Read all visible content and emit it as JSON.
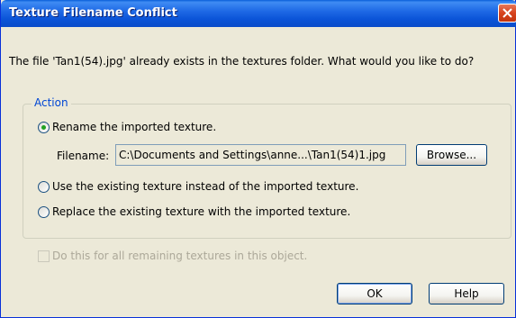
{
  "window": {
    "title": "Texture Filename Conflict"
  },
  "message": "The file 'Tan1(54).jpg' already exists in the textures folder.  What would you like to do?",
  "action_group": {
    "label": "Action",
    "options": [
      {
        "label": "Rename the imported texture.",
        "selected": true
      },
      {
        "label": "Use the existing texture instead of the imported texture.",
        "selected": false
      },
      {
        "label": "Replace the existing texture with the imported texture.",
        "selected": false
      }
    ],
    "filename": {
      "label": "Filename:",
      "value": "C:\\Documents and Settings\\anne...\\Tan1(54)1.jpg"
    },
    "browse_label": "Browse..."
  },
  "apply_all": {
    "label": "Do this for all remaining textures in this object.",
    "checked": false,
    "enabled": false
  },
  "buttons": {
    "ok": "OK",
    "help": "Help"
  },
  "colors": {
    "title_bar": "#0b54d8",
    "close_button": "#d7431d",
    "group_label": "#0046d5",
    "disabled_text": "#aca899",
    "radio_dot": "#21a121"
  }
}
